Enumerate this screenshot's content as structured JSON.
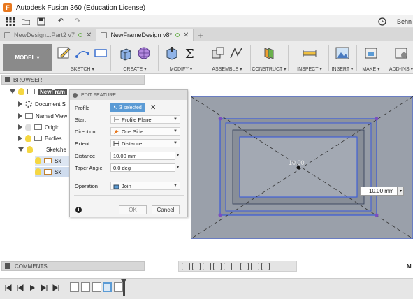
{
  "window": {
    "title": "Autodesk Fusion 360 (Education License)"
  },
  "qat": {
    "user": "Behn"
  },
  "tabs": [
    {
      "label": "NewDesign...Part2 v7",
      "active": false
    },
    {
      "label": "NewFrameDesign v8*",
      "active": true
    }
  ],
  "ribbon": {
    "workspace": "MODEL ▾",
    "groups": [
      "SKETCH ▾",
      "CREATE ▾",
      "MODIFY ▾",
      "ASSEMBLE ▾",
      "CONSTRUCT ▾",
      "INSPECT ▾",
      "INSERT ▾",
      "MAKE ▾",
      "ADD-INS ▾"
    ]
  },
  "browser": {
    "header": "BROWSER",
    "root": "NewFram",
    "items": [
      "Document S",
      "Named View",
      "Origin",
      "Bodies",
      "Sketche",
      "Sk",
      "Sk"
    ]
  },
  "dialog": {
    "title": "EDIT FEATURE",
    "profile_label": "Profile",
    "profile_value": "3 selected",
    "start_label": "Start",
    "start_value": "Profile Plane",
    "direction_label": "Direction",
    "direction_value": "One Side",
    "extent_label": "Extent",
    "extent_value": "Distance",
    "distance_label": "Distance",
    "distance_value": "10.00 mm",
    "taper_label": "Taper Angle",
    "taper_value": "0.0 deg",
    "operation_label": "Operation",
    "operation_value": "Join",
    "ok": "OK",
    "cancel": "Cancel"
  },
  "viewport": {
    "center_dim": "10.00",
    "distance_box": "10.00 mm"
  },
  "comments": {
    "label": "COMMENTS"
  },
  "status": {
    "right_text": "M"
  },
  "colors": {
    "accent": "#5b9bd5",
    "model_bg": "#8a8a8a",
    "viewport_bg": "#9aa0aa",
    "highlight_edge": "#3a5ad9"
  }
}
